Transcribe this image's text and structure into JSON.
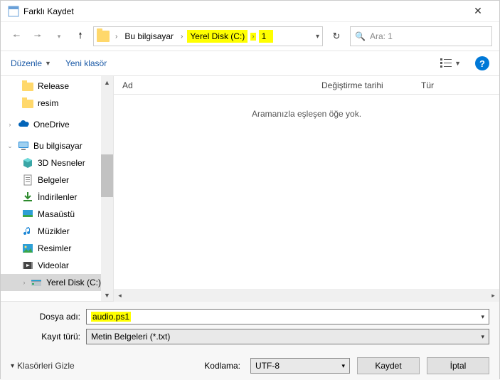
{
  "window": {
    "title": "Farklı Kaydet"
  },
  "breadcrumb": {
    "items": [
      "Bu bilgisayar",
      "Yerel Disk (C:)",
      "1"
    ],
    "highlight_from": 1
  },
  "search": {
    "placeholder": "Ara: 1"
  },
  "toolbar": {
    "organize": "Düzenle",
    "newfolder": "Yeni klasör"
  },
  "sidebar": {
    "items": [
      {
        "label": "Release",
        "icon": "folder",
        "indent": 1
      },
      {
        "label": "resim",
        "icon": "folder",
        "indent": 1
      },
      {
        "label": "",
        "icon": "spacer"
      },
      {
        "label": "OneDrive",
        "icon": "onedrive",
        "indent": 0,
        "caret": true
      },
      {
        "label": "",
        "icon": "spacer"
      },
      {
        "label": "Bu bilgisayar",
        "icon": "pc",
        "indent": 0,
        "caret": true,
        "open": true
      },
      {
        "label": "3D Nesneler",
        "icon": "3d",
        "indent": 1
      },
      {
        "label": "Belgeler",
        "icon": "doc",
        "indent": 1
      },
      {
        "label": "İndirilenler",
        "icon": "dl",
        "indent": 1
      },
      {
        "label": "Masaüstü",
        "icon": "desk",
        "indent": 1
      },
      {
        "label": "Müzikler",
        "icon": "music",
        "indent": 1
      },
      {
        "label": "Resimler",
        "icon": "pic",
        "indent": 1
      },
      {
        "label": "Videolar",
        "icon": "vid",
        "indent": 1
      },
      {
        "label": "Yerel Disk (C:)",
        "icon": "disk",
        "indent": 1,
        "caret": true,
        "selected": true
      }
    ]
  },
  "columns": {
    "name": "Ad",
    "date": "Değiştirme tarihi",
    "type": "Tür"
  },
  "content": {
    "empty_msg": "Aramanızla eşleşen öğe yok."
  },
  "form": {
    "filename_label": "Dosya adı:",
    "filename_value": "audio.ps1",
    "filetype_label": "Kayıt türü:",
    "filetype_value": "Metin Belgeleri (*.txt)",
    "encoding_label": "Kodlama:",
    "encoding_value": "UTF-8",
    "hide_folders": "Klasörleri Gizle",
    "save": "Kaydet",
    "cancel": "İptal"
  }
}
